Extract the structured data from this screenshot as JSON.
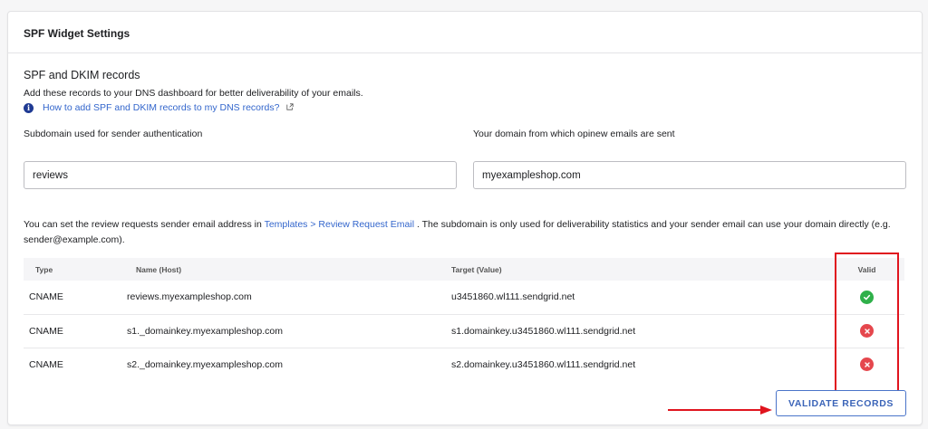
{
  "header": {
    "title": "SPF Widget Settings"
  },
  "section": {
    "title": "SPF and DKIM records",
    "description": "Add these records to your DNS dashboard for better deliverability of your emails.",
    "help_link": "How to add SPF and DKIM records to my DNS records?"
  },
  "fields": {
    "subdomain": {
      "label": "Subdomain used for sender authentication",
      "value": "reviews"
    },
    "domain": {
      "label": "Your domain from which opinew emails are sent",
      "value": "myexampleshop.com"
    }
  },
  "note": {
    "prefix": "You can set the review requests sender email address in ",
    "link": "Templates > Review Request Email",
    "suffix": " . The subdomain is only used for deliverability statistics and your sender email can use your domain directly (e.g. sender@example.com)."
  },
  "table": {
    "headers": {
      "type": "Type",
      "name": "Name (Host)",
      "target": "Target (Value)",
      "valid": "Valid"
    },
    "rows": [
      {
        "type": "CNAME",
        "name": "reviews.myexampleshop.com",
        "target": "u3451860.wl111.sendgrid.net",
        "valid": true
      },
      {
        "type": "CNAME",
        "name": "s1._domainkey.myexampleshop.com",
        "target": "s1.domainkey.u3451860.wl111.sendgrid.net",
        "valid": false
      },
      {
        "type": "CNAME",
        "name": "s2._domainkey.myexampleshop.com",
        "target": "s2.domainkey.u3451860.wl111.sendgrid.net",
        "valid": false
      }
    ]
  },
  "actions": {
    "validate_label": "VALIDATE RECORDS"
  },
  "icons": {
    "info": "info-icon",
    "external": "external-link-icon",
    "valid": "check-circle-icon",
    "invalid": "x-circle-icon",
    "annotation": "red-arrow"
  },
  "colors": {
    "link": "#3366cc",
    "valid": "#2fb04a",
    "invalid": "#e5474d",
    "annotation": "#e0141e",
    "button": "#3b64b8"
  }
}
